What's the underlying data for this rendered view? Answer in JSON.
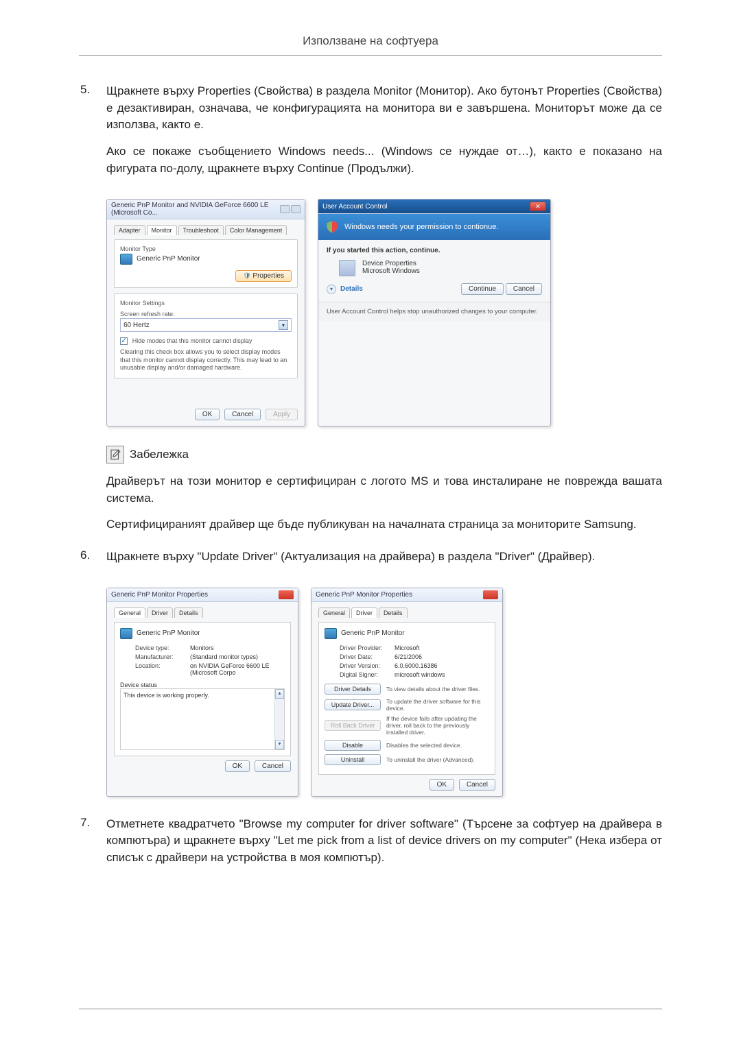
{
  "header": "Използване на софтуера",
  "steps": {
    "s5": {
      "num": "5.",
      "p1": "Щракнете върху Properties (Свойства) в раздела Monitor (Монитор). Ако бутонът Properties (Свойства) е дезактивиран, означава, че конфигурацията на монитора ви е завършена. Мониторът може да се използва, както е.",
      "p2": "Ако се покаже съобщението Windows needs... (Windows се нуждае от…), както е показано на фигурата по-долу, щракнете върху Continue (Продължи)."
    },
    "s6": {
      "num": "6.",
      "p1": "Щракнете върху \"Update Driver\" (Актуализация на драйвера) в раздела \"Driver\" (Драйвер)."
    },
    "s7": {
      "num": "7.",
      "p1": "Отметнете квадратчето \"Browse my computer for driver software\" (Търсене за софтуер на драйвера в компютъра) и щракнете върху \"Let me pick from a list of device drivers on my computer\" (Нека избера от списък с драйвери на устройства в моя компютър)."
    }
  },
  "note": {
    "title": "Забележка",
    "p1": "Драйверът на този монитор е сертифициран с логото MS и това инсталиране не поврежда вашата система.",
    "p2": "Сертифицираният драйвер ще бъде публикуван на началната страница за мониторите Samsung."
  },
  "monitorDlg": {
    "title": "Generic PnP Monitor and NVIDIA GeForce 6600 LE (Microsoft Co...",
    "tabs": {
      "adapter": "Adapter",
      "monitor": "Monitor",
      "troubleshoot": "Troubleshoot",
      "colormgmt": "Color Management"
    },
    "monitorType": "Monitor Type",
    "monitorName": "Generic PnP Monitor",
    "propsBtn": "Properties",
    "settings": "Monitor Settings",
    "refreshLabel": "Screen refresh rate:",
    "refreshValue": "60 Hertz",
    "hideModes": "Hide modes that this monitor cannot display",
    "hideDesc": "Clearing this check box allows you to select display modes that this monitor cannot display correctly. This may lead to an unusable display and/or damaged hardware.",
    "ok": "OK",
    "cancel": "Cancel",
    "apply": "Apply"
  },
  "uac": {
    "title": "User Account Control",
    "banner": "Windows needs your permission to contionue.",
    "started": "If you started this action, continue.",
    "prog": "Device Properties",
    "vendor": "Microsoft Windows",
    "details": "Details",
    "continue": "Continue",
    "cancel": "Cancel",
    "footer": "User Account Control helps stop unauthorized changes to your computer."
  },
  "drvGeneral": {
    "title": "Generic PnP Monitor Properties",
    "tabs": {
      "general": "General",
      "driver": "Driver",
      "details": "Details"
    },
    "name": "Generic PnP Monitor",
    "devtypeL": "Device type:",
    "devtypeV": "Monitors",
    "manufL": "Manufacturer:",
    "manufV": "(Standard monitor types)",
    "locL": "Location:",
    "locV": "on NVIDIA GeForce 6600 LE (Microsoft Corpo",
    "statusH": "Device status",
    "statusT": "This device is working properly.",
    "ok": "OK",
    "cancel": "Cancel"
  },
  "drvDriver": {
    "title": "Generic PnP Monitor Properties",
    "provL": "Driver Provider:",
    "provV": "Microsoft",
    "dateL": "Driver Date:",
    "dateV": "6/21/2006",
    "verL": "Driver Version:",
    "verV": "6.0.6000.16386",
    "sigL": "Digital Signer:",
    "sigV": "microsoft windows",
    "btns": {
      "details": "Driver Details",
      "detailsD": "To view details about the driver files.",
      "update": "Update Driver...",
      "updateD": "To update the driver software for this device.",
      "rollback": "Roll Back Driver",
      "rollbackD": "If the device fails after updating the driver, roll back to the previously installed driver.",
      "disable": "Disable",
      "disableD": "Disables the selected device.",
      "uninstall": "Uninstall",
      "uninstallD": "To uninstall the driver (Advanced)."
    },
    "ok": "OK",
    "cancel": "Cancel"
  }
}
